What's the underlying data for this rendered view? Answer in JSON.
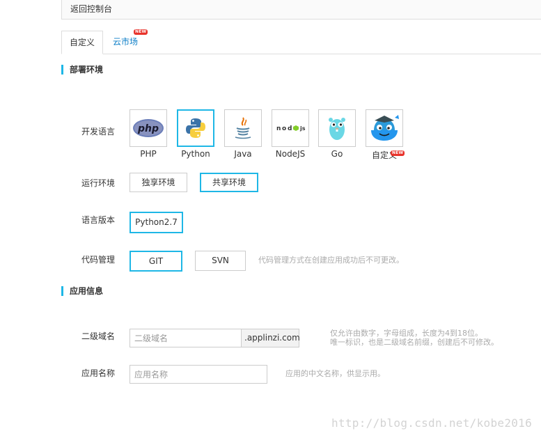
{
  "back_link": "返回控制台",
  "tabs": [
    {
      "label": "自定义",
      "active": true
    },
    {
      "label": "云市场",
      "badge": "NEW"
    }
  ],
  "sections": {
    "deploy_env": "部署环境",
    "app_info": "应用信息"
  },
  "dev_language": {
    "label": "开发语言",
    "selected": "Python",
    "options": [
      {
        "label": "PHP",
        "icon": "php-icon"
      },
      {
        "label": "Python",
        "icon": "python-icon"
      },
      {
        "label": "Java",
        "icon": "java-icon"
      },
      {
        "label": "NodeJS",
        "icon": "nodejs-icon"
      },
      {
        "label": "Go",
        "icon": "go-gopher-icon"
      },
      {
        "label": "自定义",
        "icon": "docker-whale-icon",
        "badge": "NEW"
      }
    ]
  },
  "runtime_env": {
    "label": "运行环境",
    "options": [
      "独享环境",
      "共享环境"
    ],
    "selected": "共享环境"
  },
  "lang_version": {
    "label": "语言版本",
    "options": [
      "Python2.7"
    ],
    "selected": "Python2.7"
  },
  "code_mgmt": {
    "label": "代码管理",
    "options": [
      "GIT",
      "SVN"
    ],
    "selected": "GIT",
    "hint": "代码管理方式在创建应用成功后不可更改。"
  },
  "subdomain": {
    "label": "二级域名",
    "placeholder": "二级域名",
    "value": "",
    "suffix": ".applinzi.com",
    "hint_line1": "仅允许由数字，字母组成，长度为4到18位。",
    "hint_line2": "唯一标识，也是二级域名前缀，创建后不可修改。"
  },
  "app_name": {
    "label": "应用名称",
    "placeholder": "应用名称",
    "value": "",
    "hint": "应用的中文名称，供显示用。"
  },
  "watermark": "http://blog.csdn.net/kobe2016",
  "colors": {
    "accent": "#1eb7e6",
    "link": "#0c7ec7",
    "badge": "#e8332b"
  }
}
